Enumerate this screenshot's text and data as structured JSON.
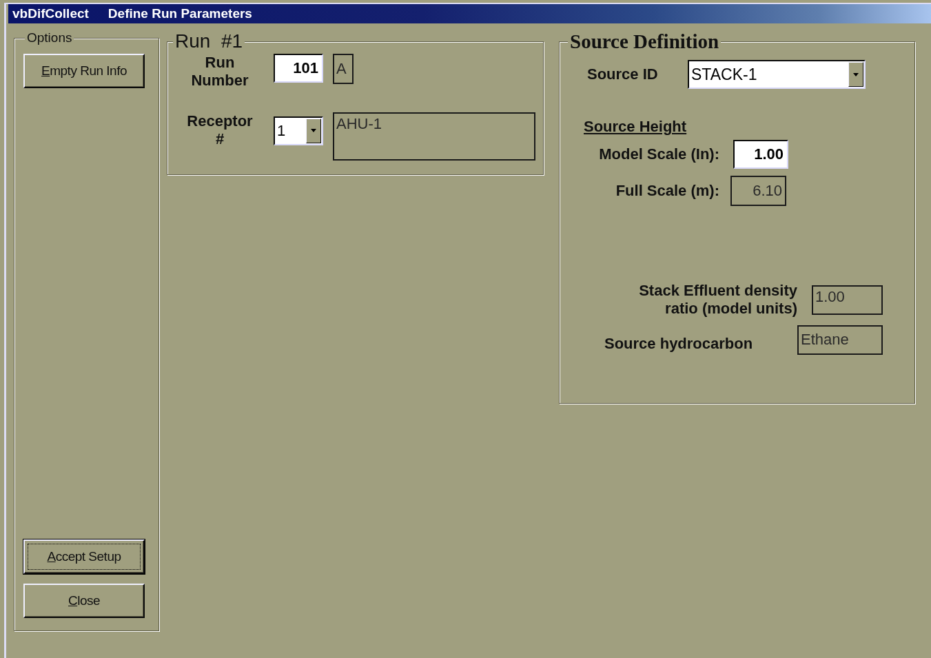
{
  "window": {
    "title": "vbDifCollect",
    "subtitle": "Define Run Parameters"
  },
  "options": {
    "label": "Options",
    "top_buttons": [
      {
        "label": "Empty Run Info",
        "default": false,
        "mnemonic_underlined": true
      }
    ],
    "bottom_buttons": [
      {
        "label": "Accept Setup",
        "default": true,
        "mnemonic_underlined": true
      },
      {
        "label": "Close",
        "default": false,
        "mnemonic_underlined": true
      }
    ]
  },
  "run": {
    "title": "Run  #1",
    "run_number": {
      "label": "Run\nNumber",
      "value": "101",
      "suffix": "A"
    },
    "receptor": {
      "label": "Receptor\n#",
      "value": "1",
      "description": "AHU-1"
    }
  },
  "source": {
    "title": "Source Definition",
    "source_id": {
      "label": "Source ID",
      "value": "STACK-1"
    },
    "height": {
      "heading": "Source Height",
      "fields": [
        {
          "label": "Model Scale (In):",
          "value": "1.00",
          "editable": true
        },
        {
          "label": "Full Scale (m):",
          "value": "6.10",
          "editable": false
        }
      ]
    },
    "density": {
      "label": "Stack Effluent density\nratio (model units)",
      "value": "1.00"
    },
    "hydrocarbon": {
      "label": "Source hydrocarbon",
      "value": "Ethane"
    }
  }
}
